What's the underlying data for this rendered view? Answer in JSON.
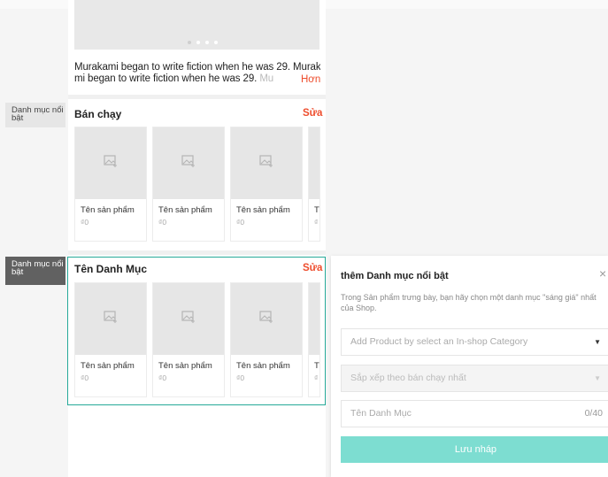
{
  "banner": {
    "description_line1": "Murakami began to write fiction when he was 29. Muraka",
    "description_line2_main": "mi began to write fiction when he was 29. ",
    "description_line2_fade": "Mu",
    "more_label": "Hơn"
  },
  "sections": [
    {
      "side_label": "Danh mục nổi bật",
      "title": "Bán chạy",
      "edit_label": "Sửa",
      "products": [
        {
          "name": "Tên sản phẩm",
          "price": "₫0"
        },
        {
          "name": "Tên sản phẩm",
          "price": "₫0"
        },
        {
          "name": "Tên sản phẩm",
          "price": "₫0"
        },
        {
          "name": "Tê",
          "price": "₫"
        }
      ]
    },
    {
      "side_label": "Danh mục nổi bật",
      "title": "Tên Danh Mục",
      "edit_label": "Sửa",
      "products": [
        {
          "name": "Tên sản phẩm",
          "price": "₫0"
        },
        {
          "name": "Tên sản phẩm",
          "price": "₫0"
        },
        {
          "name": "Tên sản phẩm",
          "price": "₫0"
        },
        {
          "name": "Tê",
          "price": "₫"
        }
      ]
    }
  ],
  "panel": {
    "title": "thêm Danh mục nổi bật",
    "close_icon": "×",
    "hint": "Trong Sản phẩm trưng bày, bạn hãy chọn một danh mục \"sáng giá\" nhất của Shop.",
    "category_select_placeholder": "Add Product by select an In-shop Category",
    "sort_select_placeholder": "Sắp xếp theo bán chạy nhất",
    "name_input_placeholder": "Tên Danh Mục",
    "name_counter": "0/40",
    "save_label": "Lưu nháp",
    "caret": "▼"
  },
  "colors": {
    "accent": "#ee4d2d",
    "selected_border": "#26aa99",
    "save_button": "#7dddd1"
  }
}
